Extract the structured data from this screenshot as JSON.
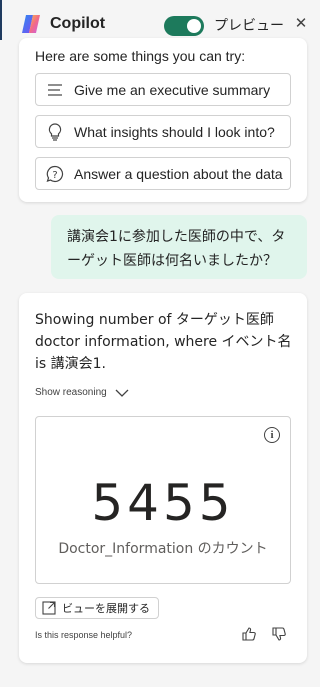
{
  "header": {
    "title": "Copilot",
    "preview_label": "プレビュー",
    "toggle_on": true,
    "close_glyph": "✕"
  },
  "suggestions": {
    "intro": "Here are some things you can try:",
    "items": [
      {
        "icon": "list-lines-icon",
        "label": "Give me an executive summary"
      },
      {
        "icon": "lightbulb-icon",
        "label": "What insights should I look into?"
      },
      {
        "icon": "chat-question-icon",
        "label": "Answer a question about the data"
      }
    ]
  },
  "user_message": {
    "text": "講演会1に参加した医師の中で、ターゲット医師は何名いましたか？"
  },
  "response": {
    "text": "Showing number of ターゲット医師 doctor information, where イベント名 is 講演会1.",
    "show_reasoning": "Show reasoning",
    "kpi_value": "5455",
    "kpi_label": "Doctor_Information のカウント",
    "expand_button": "ビューを展開する",
    "helpful_prompt": "Is this response helpful?"
  },
  "colors": {
    "toggle": "#1d7a5c",
    "user_bubble": "#e0f5ec",
    "background": "#f5f5f5"
  }
}
